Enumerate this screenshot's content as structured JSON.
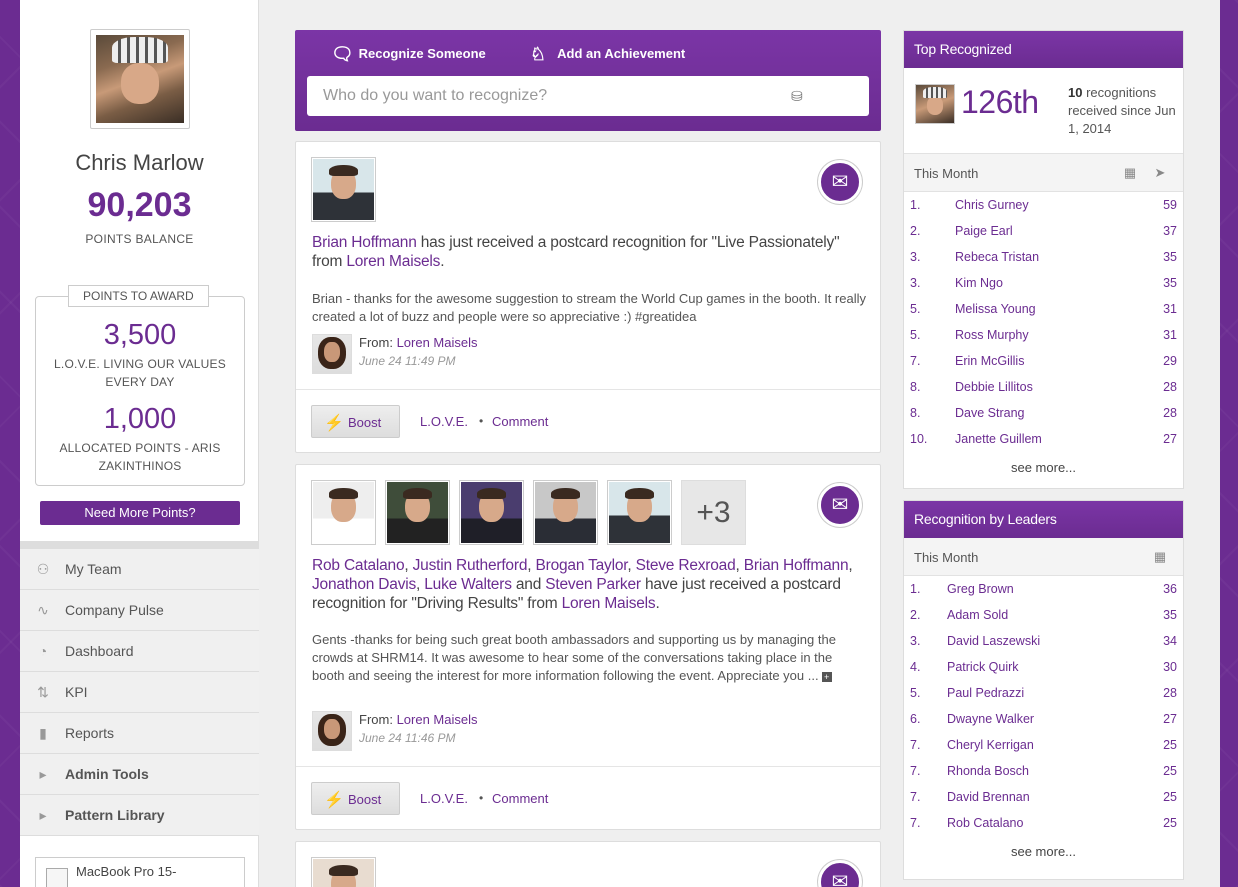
{
  "profile": {
    "name": "Chris Marlow",
    "points_balance": "90,203",
    "points_balance_label": "POINTS BALANCE"
  },
  "award": {
    "title": "POINTS TO AWARD",
    "items": [
      {
        "amount": "3,500",
        "label": "L.O.V.E. LIVING OUR VALUES EVERY DAY"
      },
      {
        "amount": "1,000",
        "label": "ALLOCATED POINTS - ARIS ZAKINTHINOS"
      }
    ],
    "need_more": "Need More Points?"
  },
  "nav": [
    {
      "label": "My Team",
      "icon": "team-icon",
      "glyph": "👥"
    },
    {
      "label": "Company Pulse",
      "icon": "pulse-icon",
      "glyph": "⩘"
    },
    {
      "label": "Dashboard",
      "icon": "dashboard-icon",
      "glyph": "◔"
    },
    {
      "label": "KPI",
      "icon": "kpi-icon",
      "glyph": "⇅"
    },
    {
      "label": "Reports",
      "icon": "reports-icon",
      "glyph": "▮"
    },
    {
      "label": "Admin Tools",
      "icon": "caret-right-icon",
      "glyph": "▸"
    },
    {
      "label": "Pattern Library",
      "icon": "caret-right-icon",
      "glyph": "▸"
    }
  ],
  "device_card": {
    "text": "MacBook Pro 15-"
  },
  "composer": {
    "tab_recognize": "Recognize Someone",
    "tab_achievement": "Add an Achievement",
    "placeholder": "Who do you want to recognize?"
  },
  "feed": [
    {
      "names": [
        "Brian Hoffmann"
      ],
      "headline_mid": " has just received a postcard recognition for \"Live Passionately\" from ",
      "giver": "Loren Maisels",
      "message": "Brian - thanks for the awesome suggestion to stream the World Cup games in the booth. It really created a lot of buzz and people were so appreciative :) #greatidea",
      "from_label": "From: ",
      "from_name": "Loren Maisels",
      "time": "June 24 11:49 PM",
      "boost": "Boost",
      "value": "L.O.V.E.",
      "comment": "Comment"
    },
    {
      "names": [
        "Rob Catalano",
        "Justin Rutherford",
        "Brogan Taylor",
        "Steve Rexroad",
        "Brian Hoffmann",
        "Jonathon Davis",
        "Luke Walters",
        "Steven Parker"
      ],
      "more_count": "+3",
      "headline_tail": " have just received a postcard recognition for \"Driving Results\" from ",
      "giver": "Loren Maisels",
      "message": "Gents -thanks for being such great booth ambassadors and supporting us by managing the crowds at SHRM14. It was awesome to hear some of the conversations taking place in the booth and seeing the interest for more information following the event. Appreciate you ...",
      "from_label": "From: ",
      "from_name": "Loren Maisels",
      "time": "June 24 11:46 PM",
      "boost": "Boost",
      "value": "L.O.V.E.",
      "comment": "Comment"
    }
  ],
  "top_recognized": {
    "title": "Top Recognized",
    "rank": "126th",
    "count": "10",
    "desc": " recognitions received since Jun 1, 2014",
    "period": "This Month",
    "rows": [
      {
        "rank": "1.",
        "name": "Chris Gurney",
        "count": "59"
      },
      {
        "rank": "2.",
        "name": "Paige Earl",
        "count": "37"
      },
      {
        "rank": "3.",
        "name": "Rebeca Tristan",
        "count": "35"
      },
      {
        "rank": "3.",
        "name": "Kim Ngo",
        "count": "35"
      },
      {
        "rank": "5.",
        "name": "Melissa Young",
        "count": "31"
      },
      {
        "rank": "5.",
        "name": "Ross Murphy",
        "count": "31"
      },
      {
        "rank": "7.",
        "name": "Erin McGillis",
        "count": "29"
      },
      {
        "rank": "8.",
        "name": "Debbie Lillitos",
        "count": "28"
      },
      {
        "rank": "8.",
        "name": "Dave Strang",
        "count": "28"
      },
      {
        "rank": "10.",
        "name": "Janette Guillem",
        "count": "27"
      }
    ],
    "see_more": "see more..."
  },
  "leaders": {
    "title": "Recognition by Leaders",
    "period": "This Month",
    "rows": [
      {
        "rank": "1.",
        "name": "Greg Brown",
        "count": "36"
      },
      {
        "rank": "2.",
        "name": "Adam Sold",
        "count": "35"
      },
      {
        "rank": "3.",
        "name": "David Laszewski",
        "count": "34"
      },
      {
        "rank": "4.",
        "name": "Patrick Quirk",
        "count": "30"
      },
      {
        "rank": "5.",
        "name": "Paul Pedrazzi",
        "count": "28"
      },
      {
        "rank": "6.",
        "name": "Dwayne Walker",
        "count": "27"
      },
      {
        "rank": "7.",
        "name": "Cheryl Kerrigan",
        "count": "25"
      },
      {
        "rank": "7.",
        "name": "Rhonda Bosch",
        "count": "25"
      },
      {
        "rank": "7.",
        "name": "David Brennan",
        "count": "25"
      },
      {
        "rank": "7.",
        "name": "Rob Catalano",
        "count": "25"
      }
    ],
    "see_more": "see more..."
  },
  "colors": {
    "brand": "#6b2c91",
    "boost": "#f2a81b"
  }
}
